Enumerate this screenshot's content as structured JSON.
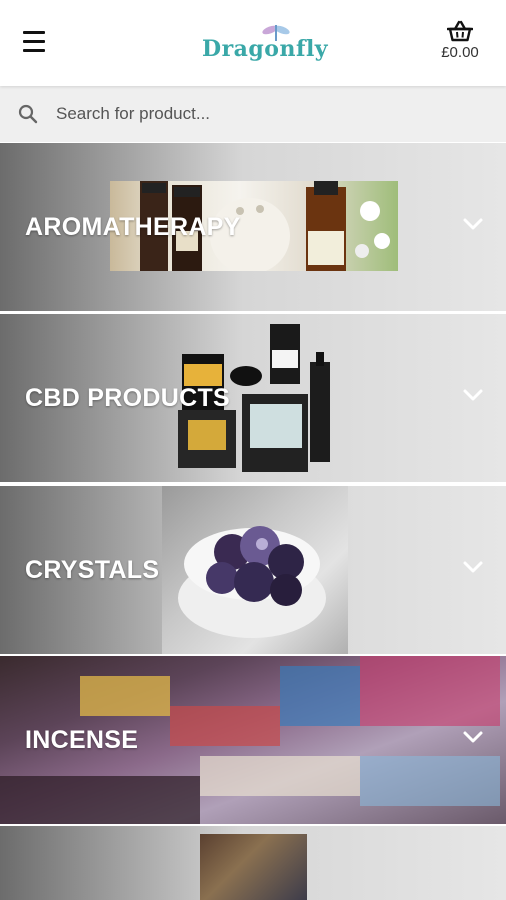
{
  "header": {
    "brand": "Dragonfly",
    "cart_total": "£0.00"
  },
  "search": {
    "placeholder": "Search for product..."
  },
  "categories": [
    {
      "label": "AROMATHERAPY"
    },
    {
      "label": "CBD PRODUCTS"
    },
    {
      "label": "CRYSTALS"
    },
    {
      "label": "INCENSE"
    },
    {
      "label": ""
    }
  ],
  "icons": {
    "menu": "menu-icon",
    "cart": "basket-icon",
    "search": "search-icon",
    "expand": "chevron-down-icon"
  },
  "colors": {
    "brand": "#3aa8a8",
    "search_bg": "#efefef"
  }
}
